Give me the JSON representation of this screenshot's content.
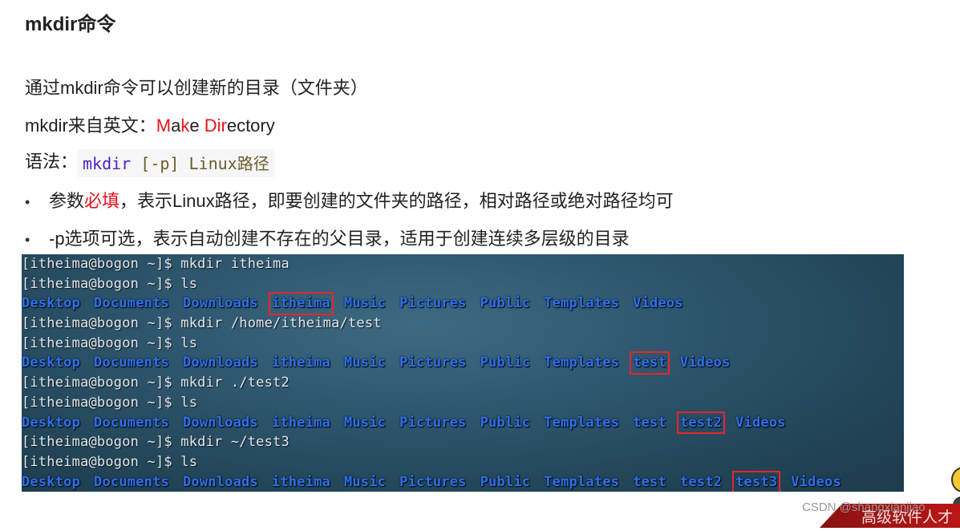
{
  "heading": "mkdir命令",
  "intro": "通过mkdir命令可以创建新的目录（文件夹）",
  "origin": {
    "prefix": "mkdir来自英文：",
    "parts": [
      {
        "text": "M",
        "red": true
      },
      {
        "text": "a",
        "red": false
      },
      {
        "text": "k",
        "red": true
      },
      {
        "text": "e ",
        "red": false
      },
      {
        "text": "Dir",
        "red": true
      },
      {
        "text": "ectory",
        "red": false
      }
    ]
  },
  "syntax": {
    "label": "语法：",
    "command": "mkdir",
    "option": "[-p]",
    "argument": "Linux路径"
  },
  "bullets": [
    {
      "dot": "•",
      "before": "参数",
      "highlight": "必填",
      "after": "，表示Linux路径，即要创建的文件夹的路径，相对路径或绝对路径均可"
    },
    {
      "dot": "•",
      "before": "-p选项可选，表示自动创建不存在的父目录，适用于创建连续多层级的目录",
      "highlight": "",
      "after": ""
    }
  ],
  "terminal": {
    "prompt": "[itheima@bogon ~]$ ",
    "lines": [
      {
        "type": "cmd",
        "text": "mkdir itheima"
      },
      {
        "type": "cmd",
        "text": "ls"
      },
      {
        "type": "ls",
        "items": [
          "Desktop",
          "Documents",
          "Downloads",
          "itheima",
          "Music",
          "Pictures",
          "Public",
          "Templates",
          "Videos"
        ],
        "highlight": [
          "itheima"
        ]
      },
      {
        "type": "cmd",
        "text": "mkdir /home/itheima/test"
      },
      {
        "type": "cmd",
        "text": "ls"
      },
      {
        "type": "ls",
        "items": [
          "Desktop",
          "Documents",
          "Downloads",
          "itheima",
          "Music",
          "Pictures",
          "Public",
          "Templates",
          "test",
          "Videos"
        ],
        "highlight": [
          "test"
        ]
      },
      {
        "type": "cmd",
        "text": "mkdir ./test2"
      },
      {
        "type": "cmd",
        "text": "ls"
      },
      {
        "type": "ls",
        "items": [
          "Desktop",
          "Documents",
          "Downloads",
          "itheima",
          "Music",
          "Pictures",
          "Public",
          "Templates",
          "test",
          "test2",
          "Videos"
        ],
        "highlight": [
          "test2"
        ]
      },
      {
        "type": "cmd",
        "text": "mkdir ~/test3"
      },
      {
        "type": "cmd",
        "text": "ls"
      },
      {
        "type": "ls",
        "items": [
          "Desktop",
          "Documents",
          "Downloads",
          "itheima",
          "Music",
          "Pictures",
          "Public",
          "Templates",
          "test",
          "test2",
          "test3",
          "Videos"
        ],
        "highlight": [
          "test3"
        ]
      }
    ]
  },
  "watermark": "CSDN @shangxianjiao",
  "banner": "高级软件人才",
  "colors": {
    "accent_red": "#e8121b",
    "dir_blue": "#2f6fe8",
    "highlight_box": "#e3262c"
  }
}
